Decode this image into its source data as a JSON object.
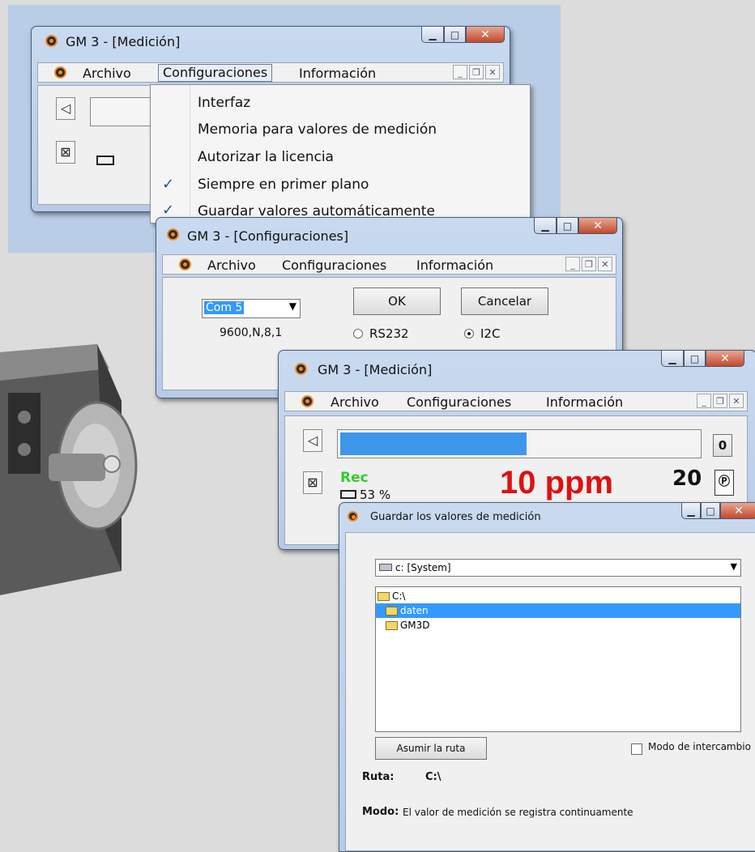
{
  "win1": {
    "title": "GM 3 - [Medición]",
    "menu": [
      "Archivo",
      "Configuraciones",
      "Información"
    ],
    "dropdown": [
      {
        "label": "Interfaz",
        "checked": false
      },
      {
        "label": "Memoria para valores de medición",
        "checked": false
      },
      {
        "label": "Autorizar la licencia",
        "checked": false
      },
      {
        "label": "Siempre en primer plano",
        "checked": true
      },
      {
        "label": "Guardar valores automáticamente",
        "checked": true
      }
    ]
  },
  "win2": {
    "title": "GM 3 - [Configuraciones]",
    "menu": [
      "Archivo",
      "Configuraciones",
      "Información"
    ],
    "port_value": "Com 5",
    "baud": "9600,N,8,1",
    "ok_label": "OK",
    "cancel_label": "Cancelar",
    "radio1_label": "RS232",
    "radio2_label": "I2C",
    "selected_radio": "I2C"
  },
  "win3": {
    "title": "GM 3 - [Medición]",
    "menu": [
      "Archivo",
      "Configuraciones",
      "Información"
    ],
    "zero_label": "0",
    "rec_label": "Rec",
    "battery": "53 %",
    "reading": "10 ppm",
    "count": "20",
    "progress_fraction": 0.52,
    "rec_color": "#33cc33",
    "reading_color": "#dd1111"
  },
  "win4": {
    "title": "Guardar los valores de medición",
    "drive": "c: [System]",
    "folders": [
      {
        "label": "C:\\",
        "indent": 0,
        "selected": false
      },
      {
        "label": "daten",
        "indent": 1,
        "selected": true
      },
      {
        "label": "GM3D",
        "indent": 1,
        "selected": false
      }
    ],
    "assume_btn": "Asumir la ruta",
    "exchange_label": "Modo de intercambio",
    "ruta_label": "Ruta:",
    "ruta_value": "C:\\",
    "modo_label": "Modo:",
    "modo_value": "El valor de medición se registra continuamente"
  },
  "icons": [
    "speaker-icon",
    "mute-icon",
    "battery-icon",
    "app-icon",
    "folder-icon",
    "drive-icon",
    "parking-icon"
  ]
}
